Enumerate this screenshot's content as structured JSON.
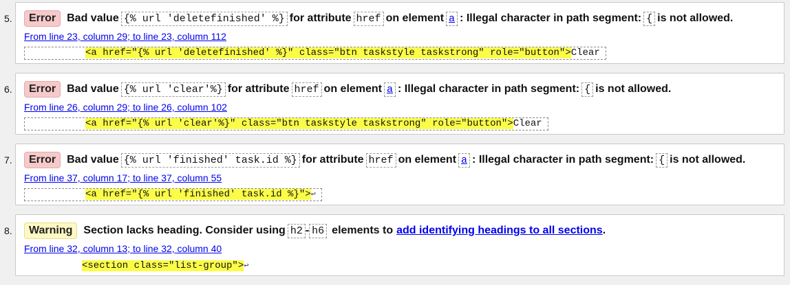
{
  "messages": [
    {
      "number": "5.",
      "badge": "Error",
      "badge_type": "error",
      "pre": "Bad value",
      "value": "{% url 'deletefinished' %}",
      "mid1": "for attribute",
      "attr": "href",
      "mid2": "on element",
      "element": "a",
      "mid3": ": Illegal character in path segment:",
      "char": "{",
      "post": "is not allowed.",
      "location": "From line 23, column 29; to line 23, column 112",
      "extract_highlight": "<a href=\"{% url 'deletefinished' %}\" class=\"btn taskstyle taskstrong\" role=\"button\">",
      "extract_tail": "Clear"
    },
    {
      "number": "6.",
      "badge": "Error",
      "badge_type": "error",
      "pre": "Bad value",
      "value": "{% url 'clear'%}",
      "mid1": "for attribute",
      "attr": "href",
      "mid2": "on element",
      "element": "a",
      "mid3": ": Illegal character in path segment:",
      "char": "{",
      "post": "is not allowed.",
      "location": "From line 26, column 29; to line 26, column 102",
      "extract_highlight": "<a href=\"{% url 'clear'%}\" class=\"btn taskstyle taskstrong\" role=\"button\">",
      "extract_tail": "Clear"
    },
    {
      "number": "7.",
      "badge": "Error",
      "badge_type": "error",
      "pre": "Bad value",
      "value": "{% url 'finished' task.id %}",
      "mid1": "for attribute",
      "attr": "href",
      "mid2": "on element",
      "element": "a",
      "mid3": ": Illegal character in path segment:",
      "char": "{",
      "post": "is not allowed.",
      "location": "From line 37, column 17; to line 37, column 55",
      "extract_highlight": "<a href=\"{% url 'finished' task.id %}\">",
      "extract_tail": "↩"
    },
    {
      "number": "8.",
      "badge": "Warning",
      "badge_type": "warning",
      "text1": "Section lacks heading. Consider using",
      "code1": "h2",
      "dash": "-",
      "code2": "h6",
      "text2": "elements to",
      "link": "add identifying headings to all sections",
      "text3": ".",
      "location": "From line 32, column 13; to line 32, column 40",
      "extract_highlight": "<section class=\"list-group\">",
      "extract_tail": "↩"
    }
  ]
}
